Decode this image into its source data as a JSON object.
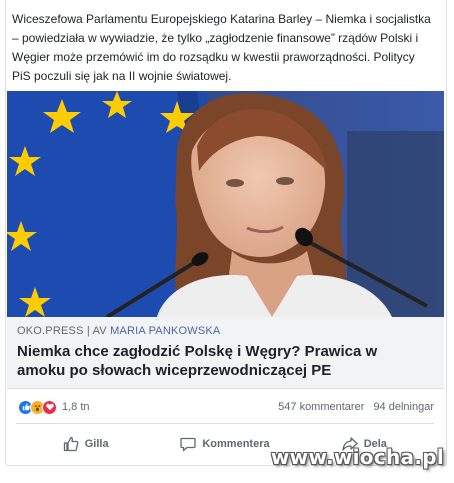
{
  "post": {
    "text": "Wiceszefowa Parlamentu Europejskiego Katarina Barley – Niemka i socjalistka – powiedziała w wywiadzie, że tylko „zagłodzenie finansowe” rządów Polski i Węgier może przemówić im do rozsądku w kwestii praworządności. Politycy PiS poczuli się jak na II wojnie światowej."
  },
  "link": {
    "source": "OKO.PRESS",
    "separator": " | AV ",
    "author": "MARIA PANKOWSKA",
    "title": "Niemka chce zagłodzić Polskę i Węgry? Prawica w amoku po słowach wiceprzewodniczącej PE"
  },
  "reactions": {
    "icons": [
      "like-reaction",
      "wow-reaction",
      "love-reaction"
    ],
    "count": "1,8 tn"
  },
  "stats": {
    "comments": "547 kommentarer",
    "shares": "94 delningar"
  },
  "actions": {
    "like": "Gilla",
    "comment": "Kommentera",
    "share": "Dela"
  },
  "watermark": "www.wiocha.pl",
  "colors": {
    "link_author": "#4b67a1",
    "like_blue": "#1877f2",
    "love_red": "#f0284a",
    "wow_yellow": "#f7b125",
    "eu_blue": "#1a3f8f",
    "eu_star": "#ffcc00"
  }
}
